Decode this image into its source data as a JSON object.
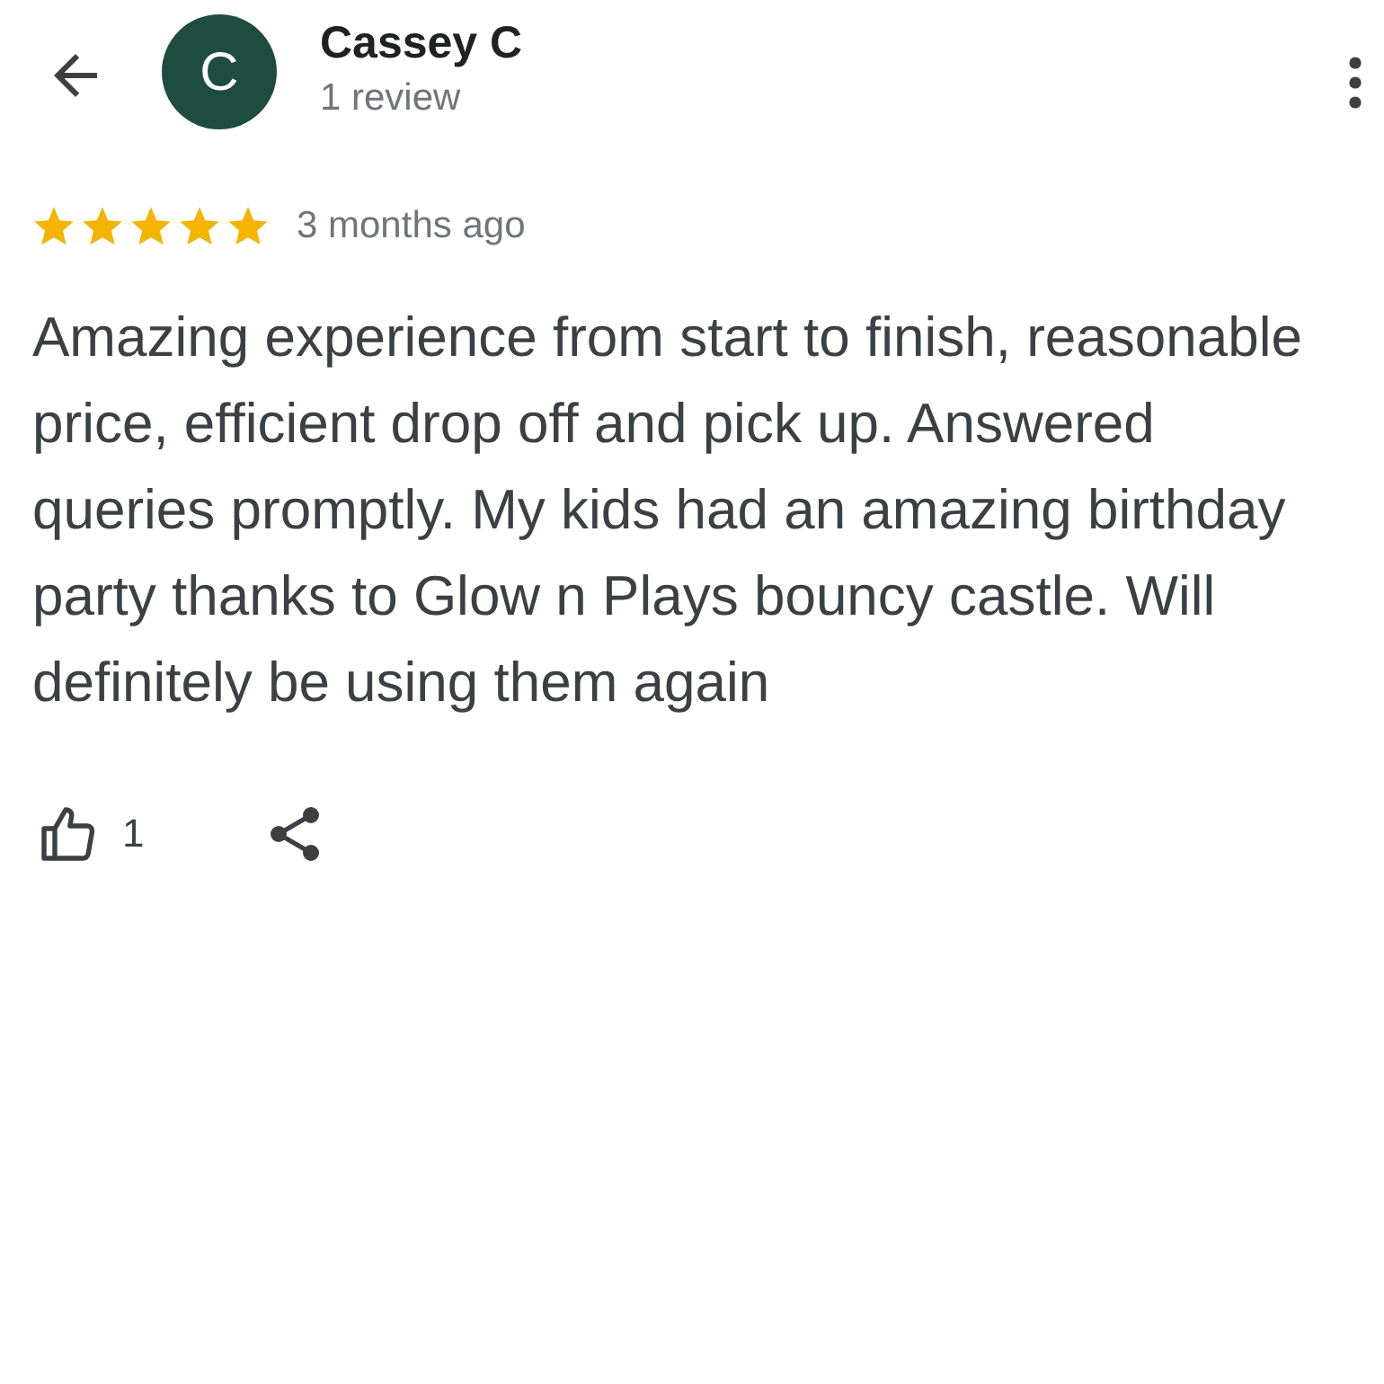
{
  "header": {
    "avatar_letter": "C",
    "name": "Cassey C",
    "subtitle": "1 review"
  },
  "review": {
    "stars": 5,
    "time": "3 months ago",
    "text": "Amazing experience from start to finish, reasonable price, efficient drop off and pick up. Answered queries promptly. My kids had an amazing birthday party thanks to Glow n Plays bouncy castle. Will definitely be using them again"
  },
  "actions": {
    "like_count": "1"
  }
}
